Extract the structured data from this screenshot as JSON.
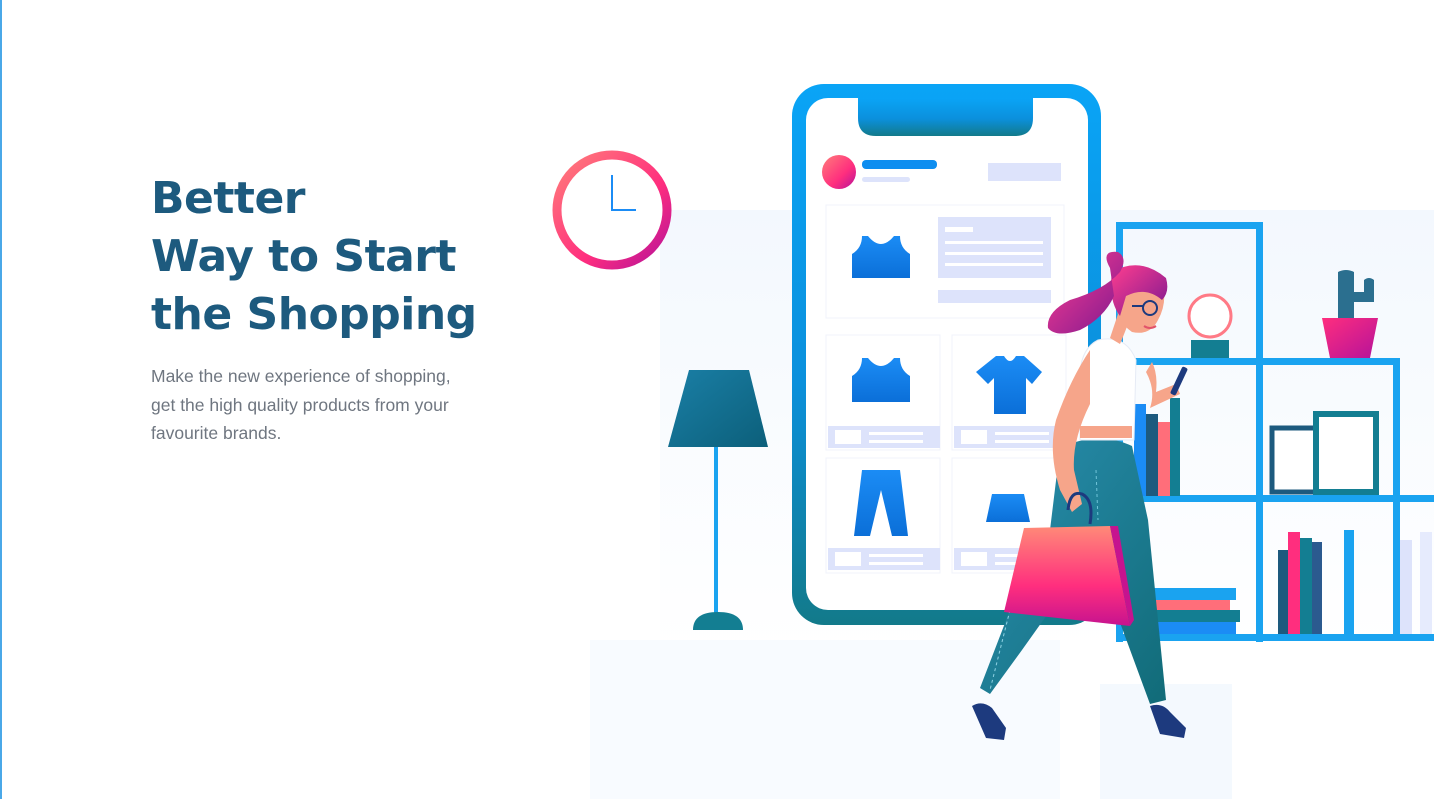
{
  "hero": {
    "title_lines": [
      "Better",
      "Way to Start",
      "the Shopping"
    ],
    "subtitle_lines": [
      "Make the new experience of shopping,",
      "get the high quality products from your",
      "favourite brands."
    ]
  },
  "colors": {
    "title": "#1d5a7e",
    "body_text": "#6f7680",
    "brand_blue": "#0e8ef0",
    "phone_gradient_top": "#0aa4f6",
    "phone_gradient_bottom": "#127a8a",
    "pink": "#ff2e7e",
    "magenta": "#b5129a",
    "teal": "#137e92",
    "panel_lavender": "#dde3fb"
  },
  "icons": {
    "clock": "clock-icon",
    "lamp": "floor-lamp-icon",
    "phone": "smartphone-icon",
    "tank_top": "tank-top-icon",
    "tshirt": "tshirt-icon",
    "pants": "pants-icon",
    "skirt": "skirt-icon",
    "shopper": "shopping-woman-figure",
    "bags": "shopping-bags-icon",
    "shelf": "bookshelf-icon",
    "cactus": "cactus-pot-icon",
    "mirror": "round-mirror-icon",
    "frames": "picture-frames-icon",
    "books": "books-icon"
  }
}
